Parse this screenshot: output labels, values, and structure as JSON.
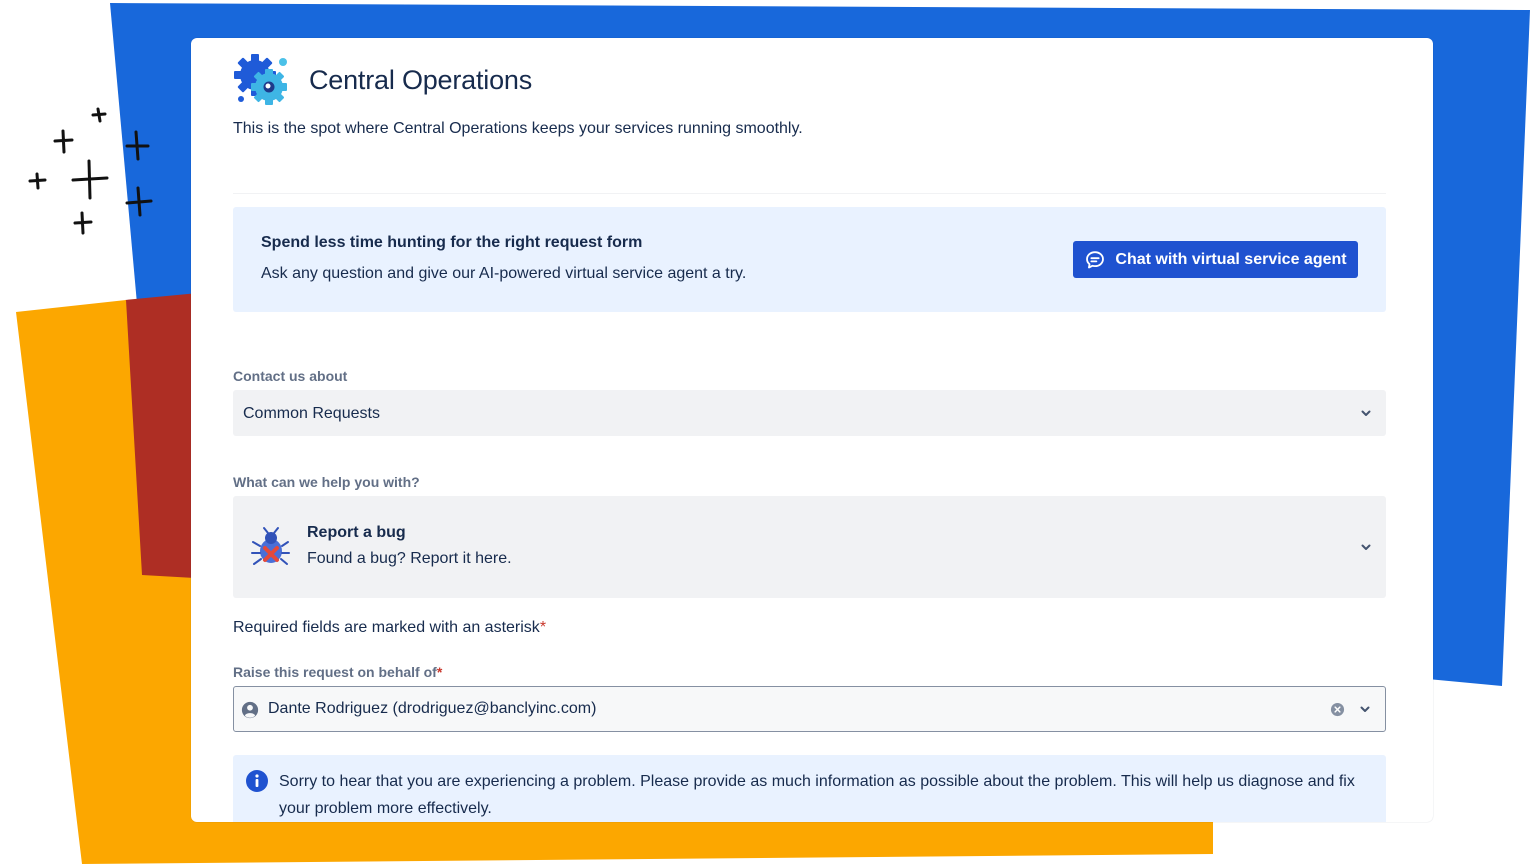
{
  "portal": {
    "title": "Central Operations",
    "subtitle": "This is the spot where Central Operations keeps your services running smoothly."
  },
  "promo": {
    "title": "Spend less time hunting for the right request form",
    "text": "Ask any question and give our AI-powered virtual service agent a try.",
    "button_label": "Chat with virtual service agent",
    "button_icon": "chat-bubble-icon"
  },
  "contact": {
    "label": "Contact us about",
    "value": "Common Requests"
  },
  "help": {
    "label": "What can we help you with?",
    "request_type": {
      "title": "Report a bug",
      "description": "Found a bug? Report it here.",
      "icon": "bug-icon"
    }
  },
  "form": {
    "required_note": "Required fields are marked with an asterisk",
    "asterisk": "*",
    "on_behalf_label": "Raise this request on behalf of",
    "on_behalf_value": "Dante Rodriguez (drodriguez@banclyinc.com)"
  },
  "info_message": "Sorry to hear that you are experiencing a problem.  Please provide as much information as possible about the problem. This will help us diagnose and fix your problem more effectively.",
  "colors": {
    "primary_button": "#1f52d0",
    "info_background": "#e9f2ff",
    "field_background": "#f1f2f4",
    "required_asterisk": "#c9372c",
    "backdrop_blue": "#1868db",
    "backdrop_red": "#ae2e24",
    "backdrop_yellow": "#fca700"
  }
}
